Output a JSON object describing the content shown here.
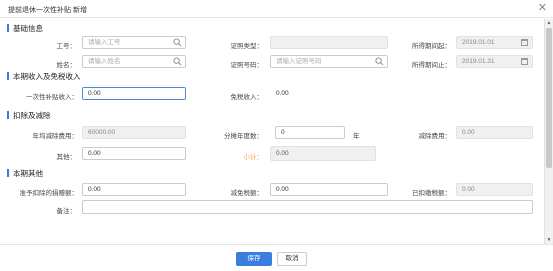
{
  "dialog": {
    "title": "提前退休一次性补贴 新增",
    "close_glyph": "✕"
  },
  "sections": {
    "basic": "基础信息",
    "income": "本期收入及免税收入",
    "deduction": "扣除及减除",
    "other": "本期其他"
  },
  "basic": {
    "employee_id_label": "工号：",
    "employee_id_placeholder": "请输入工号",
    "name_label": "姓名：",
    "name_placeholder": "请输入姓名",
    "id_type_label": "证照类型：",
    "id_type_value": "",
    "id_number_label": "证照号码：",
    "id_number_placeholder": "请输入证照号码",
    "period_start_label": "所得期间起：",
    "period_start_value": "2019.01.01",
    "period_end_label": "所得期间止：",
    "period_end_value": "2019.01.31"
  },
  "income": {
    "subsidy_label": "一次性补贴收入：",
    "subsidy_value": "0.00",
    "tax_free_label": "免税收入：",
    "tax_free_value": "0.00"
  },
  "deduction": {
    "annual_deduction_label": "年均减除费用：",
    "annual_deduction_value": "60000.00",
    "years_label": "分摊年度数：",
    "years_value": "0",
    "years_unit": "年",
    "deduction_fee_label": "减除费用：",
    "deduction_fee_value": "0.00",
    "other_label": "其他：",
    "other_value": "0.00",
    "subtotal_label": "小计：",
    "subtotal_value": "0.00"
  },
  "other": {
    "donation_label": "准予扣除的捐赠额：",
    "donation_value": "0.00",
    "tax_relief_label": "减免税额：",
    "tax_relief_value": "0.00",
    "prepaid_tax_label": "已扣缴税额：",
    "prepaid_tax_value": "0.00",
    "remark_label": "备注：",
    "remark_value": ""
  },
  "footer": {
    "save_label": "保存",
    "cancel_label": "取消"
  },
  "colors": {
    "accent": "#3b7ddd",
    "subtotal": "#f0a030"
  }
}
